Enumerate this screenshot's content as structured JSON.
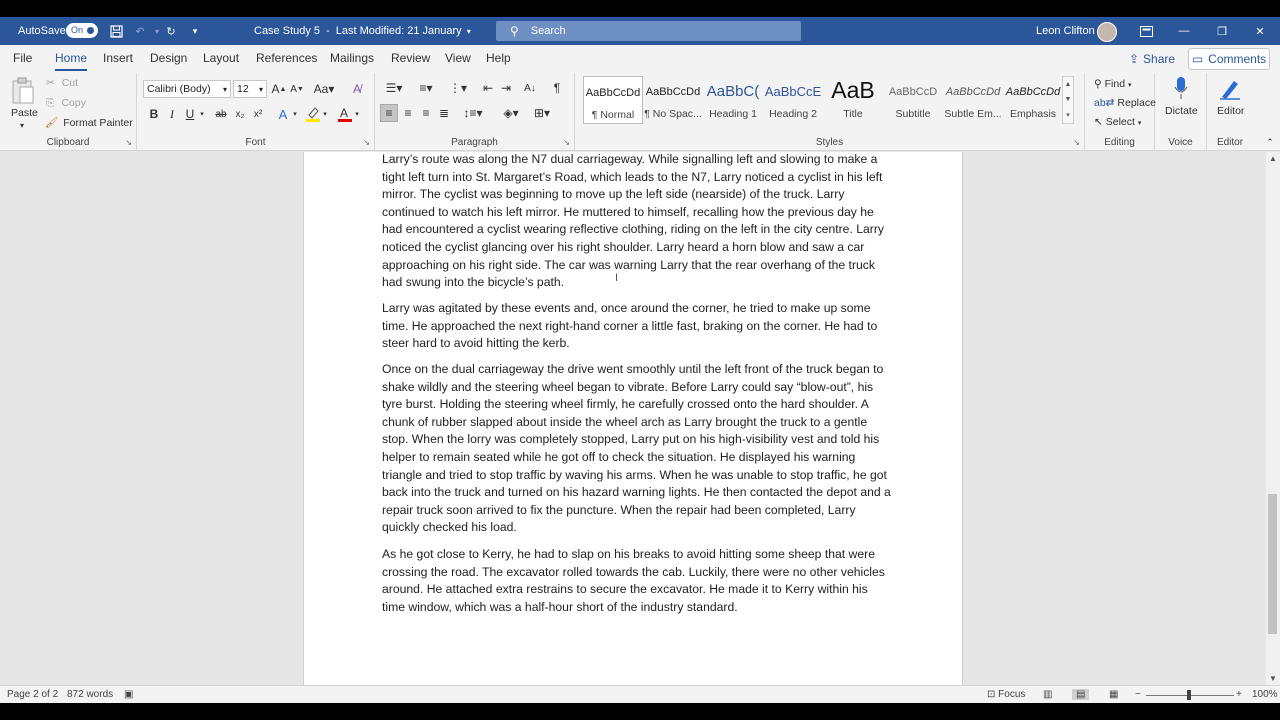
{
  "titlebar": {
    "autosave_label": "AutoSave",
    "autosave_state": "On",
    "document_title": "Case Study 5",
    "last_modified": "Last Modified: 21 January",
    "search_placeholder": "Search",
    "user_name": "Leon Clifton"
  },
  "tabs": [
    "File",
    "Home",
    "Insert",
    "Design",
    "Layout",
    "References",
    "Mailings",
    "Review",
    "View",
    "Help"
  ],
  "active_tab": "Home",
  "share_label": "Share",
  "comments_label": "Comments",
  "clipboard": {
    "paste": "Paste",
    "cut": "Cut",
    "copy": "Copy",
    "format_painter": "Format Painter",
    "label": "Clipboard"
  },
  "font": {
    "family": "Calibri (Body)",
    "size": "12",
    "label": "Font"
  },
  "paragraph": {
    "label": "Paragraph"
  },
  "styles": {
    "label": "Styles",
    "items": [
      {
        "preview": "AaBbCcDd",
        "name": "¶ Normal"
      },
      {
        "preview": "AaBbCcDd",
        "name": "¶ No Spac..."
      },
      {
        "preview": "AaBbC(",
        "name": "Heading 1"
      },
      {
        "preview": "AaBbCcE",
        "name": "Heading 2"
      },
      {
        "preview": "AaB",
        "name": "Title"
      },
      {
        "preview": "AaBbCcD",
        "name": "Subtitle"
      },
      {
        "preview": "AaBbCcDd",
        "name": "Subtle Em..."
      },
      {
        "preview": "AaBbCcDd",
        "name": "Emphasis"
      }
    ]
  },
  "editing": {
    "find": "Find",
    "replace": "Replace",
    "select": "Select",
    "label": "Editing"
  },
  "voice": {
    "dictate": "Dictate",
    "label": "Voice"
  },
  "editor": {
    "button": "Editor",
    "label": "Editor"
  },
  "document": {
    "paragraphs": [
      "Larry’s route was along the N7 dual carriageway. While signalling left and slowing to make a tight left turn into St. Margaret’s Road, which leads to the N7, Larry noticed a cyclist in his left mirror. The cyclist was beginning to move up the left side (nearside) of the truck. Larry continued to watch his left mirror. He muttered to himself, recalling how the previous day he had encountered a cyclist wearing reflective clothing, riding on the left in the city centre. Larry noticed the cyclist glancing over his right shoulder. Larry heard a horn blow and saw a car approaching on his right side. The car was warning Larry that the rear overhang of the truck had swung into the bicycle’s path.",
      "Larry was agitated by these events and, once around the corner, he tried to make up some time. He approached the next right-hand corner a little fast, braking on the corner. He had to steer hard to avoid hitting the kerb.",
      "Once on the dual carriageway the drive went smoothly until the left front of the truck began to shake wildly and the steering wheel began to vibrate. Before Larry could say “blow-out”, his tyre burst. Holding the steering wheel firmly, he carefully crossed onto the hard shoulder. A chunk of rubber slapped about inside the wheel arch as Larry brought the truck to a gentle stop. When the lorry was completely stopped, Larry put on his high-visibility vest and told his helper to remain seated while he got off to check the situation. He displayed his warning triangle and tried to stop traffic by waving his arms. When he was unable to stop traffic, he got back into the truck and turned on his hazard warning lights. He then contacted the depot and a repair truck soon arrived to fix the puncture. When the repair had been completed, Larry quickly checked his load.",
      "As he got close to Kerry, he had to slap on his breaks to avoid hitting some sheep that were crossing the road. The excavator rolled towards the cab. Luckily, there were no other vehicles around. He attached extra restrains to secure the excavator. He made it to Kerry within his time window, which was a half-hour short of the industry standard."
    ]
  },
  "statusbar": {
    "page": "Page 2 of 2",
    "words": "872 words",
    "focus": "Focus",
    "zoom": "100%"
  }
}
